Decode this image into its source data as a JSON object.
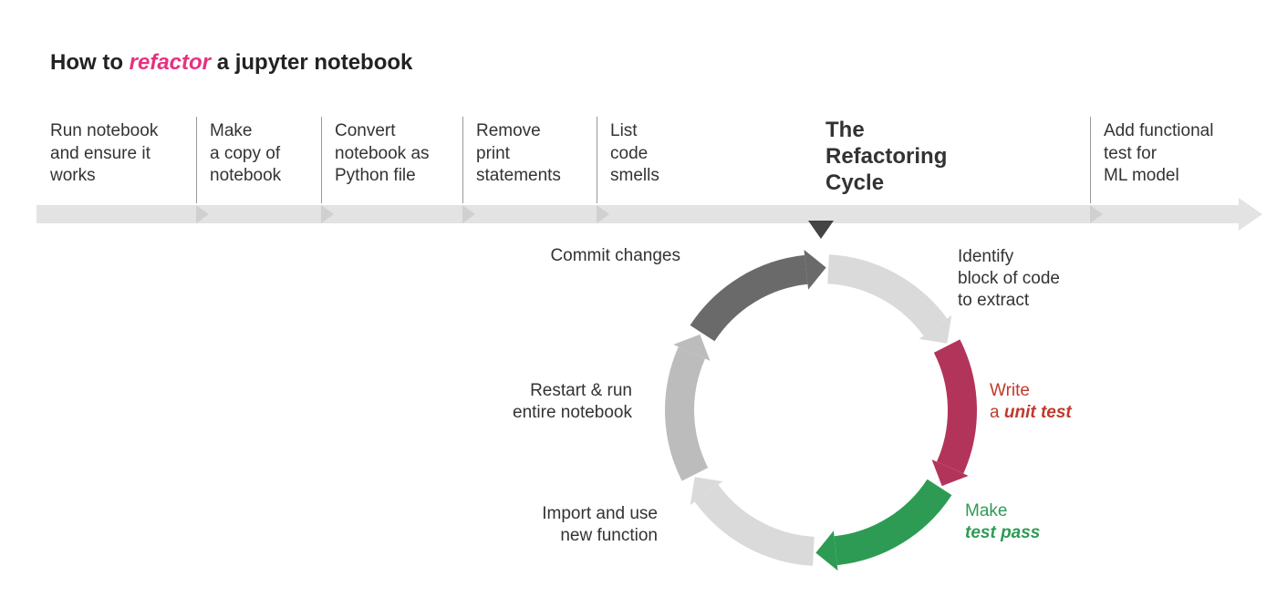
{
  "title": {
    "prefix": "How to ",
    "highlight": "refactor",
    "suffix": " a jupyter notebook"
  },
  "steps": [
    {
      "l1": "Run notebook",
      "l2": "and ensure it",
      "l3": "works"
    },
    {
      "l1": "Make",
      "l2": "a copy of",
      "l3": "notebook"
    },
    {
      "l1": "Convert",
      "l2": "notebook as",
      "l3": "Python file"
    },
    {
      "l1": "Remove",
      "l2": "print",
      "l3": "statements"
    },
    {
      "l1": "List",
      "l2": "code",
      "l3": "smells"
    }
  ],
  "cycle_title": {
    "l1": "The",
    "l2": "Refactoring",
    "l3": "Cycle"
  },
  "final_step": {
    "l1": "Add functional",
    "l2": "test for",
    "l3": "ML model"
  },
  "cycle_labels": {
    "identify": {
      "l1": "Identify",
      "l2": "block of code",
      "l3": "to extract"
    },
    "write": {
      "l1": "Write",
      "l2_pre": "a ",
      "l2_em": "unit test"
    },
    "make": {
      "l1": "Make",
      "l2_em": "test pass"
    },
    "import": {
      "l1": "Import and use",
      "l2": "new function"
    },
    "restart": {
      "l1": "Restart & run",
      "l2": "entire notebook"
    },
    "commit": {
      "l1": "Commit changes"
    }
  },
  "colors": {
    "arrow_grey": "#e3e3e3",
    "arc_lightgrey": "#dadada",
    "arc_grey": "#bcbcbc",
    "arc_darkgrey": "#6a6a6a",
    "arc_darker": "#4f4f4f",
    "arc_red": "#b3345b",
    "arc_green": "#2e9b55",
    "highlight_pink": "#e6317f"
  }
}
